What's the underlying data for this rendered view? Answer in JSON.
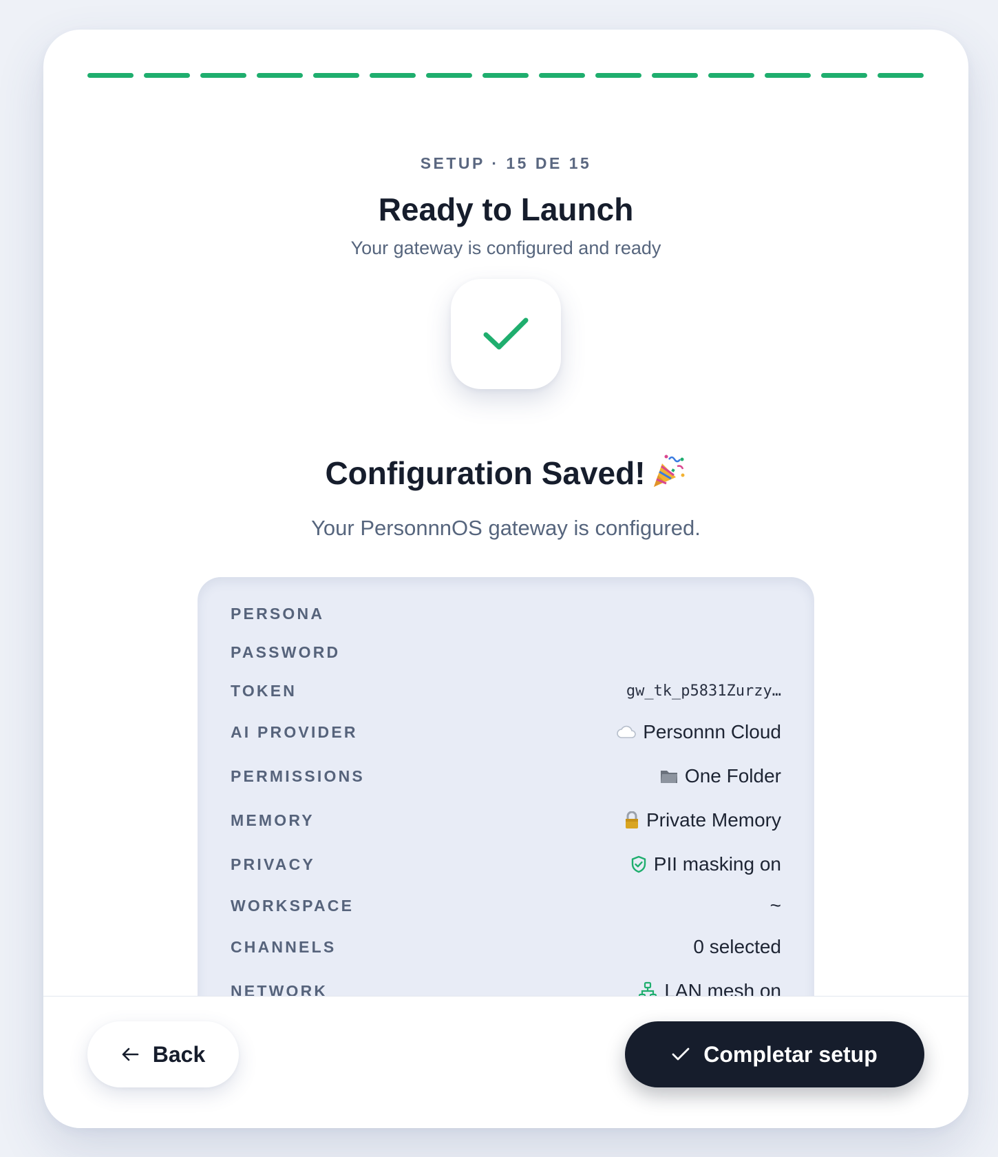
{
  "progress": {
    "total_steps": 15,
    "completed_steps": 15,
    "color": "#1fae6e"
  },
  "header": {
    "eyebrow": "SETUP · 15 DE 15",
    "title": "Ready to Launch",
    "subtitle": "Your gateway is configured and ready"
  },
  "status": {
    "icon": "check-icon",
    "heading": "Configuration Saved!",
    "heading_emoji": "party-popper-icon",
    "message": "Your PersonnnOS gateway is configured."
  },
  "summary": {
    "rows": [
      {
        "label": "PERSONA",
        "value": ""
      },
      {
        "label": "PASSWORD",
        "value": ""
      },
      {
        "label": "TOKEN",
        "value": "gw_tk_p5831Zurzy…"
      },
      {
        "label": "AI PROVIDER",
        "value": "Personnn Cloud",
        "icon": "cloud-icon"
      },
      {
        "label": "PERMISSIONS",
        "value": "One Folder",
        "icon": "folder-icon"
      },
      {
        "label": "MEMORY",
        "value": "Private Memory",
        "icon": "lock-icon"
      },
      {
        "label": "PRIVACY",
        "value": "PII masking on",
        "icon": "shield-check-icon"
      },
      {
        "label": "WORKSPACE",
        "value": "~"
      },
      {
        "label": "CHANNELS",
        "value": "0 selected"
      },
      {
        "label": "NETWORK",
        "value": "LAN mesh on",
        "icon": "network-icon"
      }
    ]
  },
  "footer": {
    "back_label": "Back",
    "complete_label": "Completar setup"
  },
  "colors": {
    "accent": "#1fae6e",
    "primary_button": "#161d2c",
    "text_dark": "#161d2c",
    "text_muted": "#56657d"
  }
}
